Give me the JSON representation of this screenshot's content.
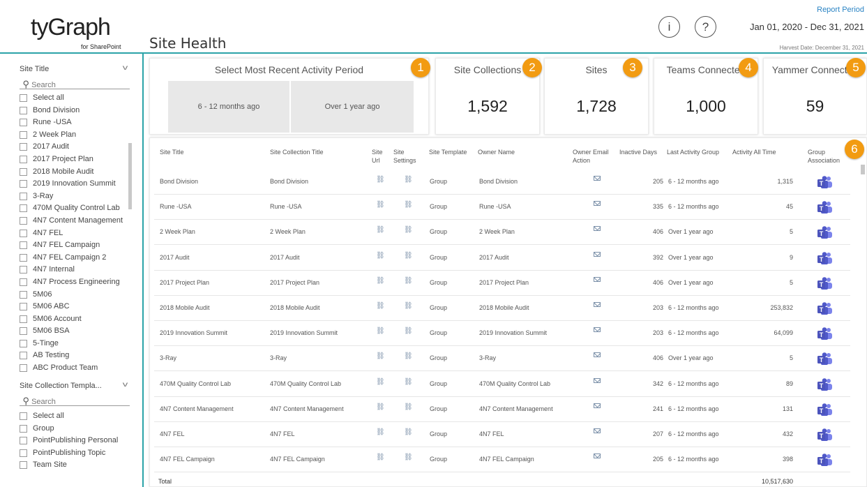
{
  "brand": {
    "logo_main": "tyGraph",
    "logo_sub": "for SharePoint"
  },
  "header": {
    "page_title": "Site Health",
    "info_icon": "i",
    "help_icon": "?",
    "report_period_label": "Report Period",
    "report_period_value": "Jan 01, 2020 - Dec 31, 2021",
    "harvest_date": "Harvest Date: December 31, 2021"
  },
  "sidebar": {
    "site_title_slicer": {
      "title": "Site Title",
      "search_placeholder": "Search",
      "options": [
        "Select all",
        "Bond Division",
        "Rune -USA",
        "2 Week Plan",
        "2017 Audit",
        "2017 Project Plan",
        "2018 Mobile Audit",
        "2019 Innovation Summit",
        "3-Ray",
        "470M Quality Control Lab",
        "4N7 Content Management",
        "4N7 FEL",
        "4N7 FEL Campaign",
        "4N7 FEL Campaign 2",
        "4N7 Internal",
        "4N7 Process Engineering",
        "5M06",
        "5M06 ABC",
        "5M06 Account",
        "5M06 BSA",
        "5-Tinge",
        "AB Testing",
        "ABC Product Team"
      ]
    },
    "template_slicer": {
      "title": "Site Collection Templa...",
      "search_placeholder": "Search",
      "options": [
        "Select all",
        "Group",
        "PointPublishing Personal",
        "PointPublishing Topic",
        "Team Site"
      ]
    }
  },
  "activity_card": {
    "title": "Select Most Recent Activity Period",
    "options": [
      "6 - 12 months ago",
      "Over 1 year ago"
    ],
    "marker": "1"
  },
  "kpis": [
    {
      "title": "Site Collections",
      "value": "1,592",
      "marker": "2"
    },
    {
      "title": "Sites",
      "value": "1,728",
      "marker": "3"
    },
    {
      "title": "Teams Connected",
      "value": "1,000",
      "marker": "4"
    },
    {
      "title": "Yammer Connected",
      "value": "59",
      "marker": "5"
    }
  ],
  "table": {
    "marker": "6",
    "columns": [
      "Site Title",
      "Site Collection Title",
      "Site Url",
      "Site Settings",
      "Site Template",
      "Owner Name",
      "Owner Email Action",
      "Inactive Days",
      "Last Activity Group",
      "Activity All Time",
      "Group Association"
    ],
    "rows": [
      {
        "site_title": "Bond Division",
        "collection_title": "Bond Division",
        "template": "Group",
        "owner": "Bond Division",
        "inactive": "205",
        "group": "6 - 12 months ago",
        "activity": "1,315"
      },
      {
        "site_title": "Rune -USA",
        "collection_title": "Rune -USA",
        "template": "Group",
        "owner": "Rune -USA",
        "inactive": "335",
        "group": "6 - 12 months ago",
        "activity": "45"
      },
      {
        "site_title": "2 Week Plan",
        "collection_title": "2 Week Plan",
        "template": "Group",
        "owner": "2 Week Plan",
        "inactive": "406",
        "group": "Over 1 year ago",
        "activity": "5"
      },
      {
        "site_title": "2017 Audit",
        "collection_title": "2017 Audit",
        "template": "Group",
        "owner": "2017 Audit",
        "inactive": "392",
        "group": "Over 1 year ago",
        "activity": "9"
      },
      {
        "site_title": "2017 Project Plan",
        "collection_title": "2017 Project Plan",
        "template": "Group",
        "owner": "2017 Project Plan",
        "inactive": "406",
        "group": "Over 1 year ago",
        "activity": "5"
      },
      {
        "site_title": "2018 Mobile Audit",
        "collection_title": "2018 Mobile Audit",
        "template": "Group",
        "owner": "2018 Mobile Audit",
        "inactive": "203",
        "group": "6 - 12 months ago",
        "activity": "253,832"
      },
      {
        "site_title": "2019 Innovation Summit",
        "collection_title": "2019 Innovation Summit",
        "template": "Group",
        "owner": "2019 Innovation Summit",
        "inactive": "203",
        "group": "6 - 12 months ago",
        "activity": "64,099"
      },
      {
        "site_title": "3-Ray",
        "collection_title": "3-Ray",
        "template": "Group",
        "owner": "3-Ray",
        "inactive": "406",
        "group": "Over 1 year ago",
        "activity": "5"
      },
      {
        "site_title": "470M Quality Control Lab",
        "collection_title": "470M Quality Control Lab",
        "template": "Group",
        "owner": "470M Quality Control Lab",
        "inactive": "342",
        "group": "6 - 12 months ago",
        "activity": "89"
      },
      {
        "site_title": "4N7 Content Management",
        "collection_title": "4N7 Content Management",
        "template": "Group",
        "owner": "4N7 Content Management",
        "inactive": "241",
        "group": "6 - 12 months ago",
        "activity": "131"
      },
      {
        "site_title": "4N7 FEL",
        "collection_title": "4N7 FEL",
        "template": "Group",
        "owner": "4N7 FEL",
        "inactive": "207",
        "group": "6 - 12 months ago",
        "activity": "432"
      },
      {
        "site_title": "4N7 FEL Campaign",
        "collection_title": "4N7 FEL Campaign",
        "template": "Group",
        "owner": "4N7 FEL Campaign",
        "inactive": "205",
        "group": "6 - 12 months ago",
        "activity": "398"
      }
    ],
    "total_label": "Total",
    "total_value": "10,517,630"
  },
  "colors": {
    "accent_teal": "#2ba3a8",
    "marker_orange": "#f29b12",
    "teams_purple": "#5059c9",
    "link_blue": "#2b84c4"
  }
}
